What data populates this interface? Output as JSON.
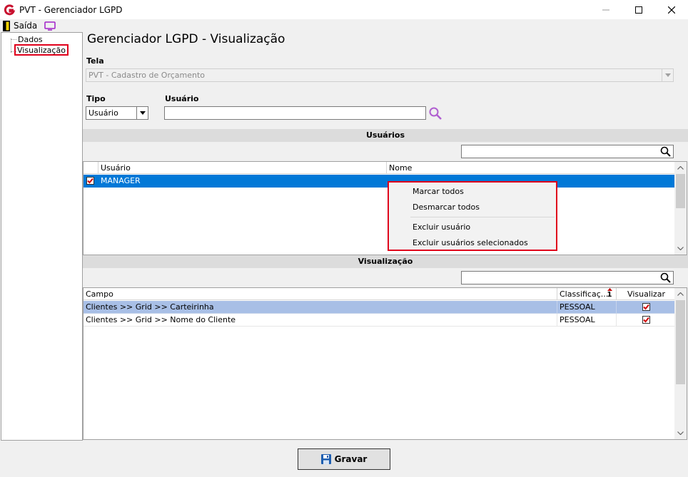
{
  "window": {
    "title": "PVT - Gerenciador LGPD"
  },
  "toolbar": {
    "exit_label": "Saída"
  },
  "sidebar": {
    "items": [
      {
        "label": "Dados"
      },
      {
        "label": "Visualização"
      }
    ]
  },
  "page_title": "Gerenciador LGPD - Visualização",
  "tela": {
    "label": "Tela",
    "value": "PVT - Cadastro de Orçamento"
  },
  "tipo": {
    "label": "Tipo",
    "value": "Usuário"
  },
  "usuario": {
    "label": "Usuário",
    "value": ""
  },
  "usuarios_section": {
    "title": "Usuários",
    "columns": [
      "Usuário",
      "Nome"
    ],
    "rows": [
      {
        "checked": true,
        "usuario": "MANAGER",
        "nome": ""
      }
    ]
  },
  "context_menu": {
    "items": [
      "Marcar todos",
      "Desmarcar todos",
      "Excluir usuário",
      "Excluir usuários selecionados"
    ]
  },
  "visualizacao_section": {
    "title": "Visualização",
    "columns": [
      "Campo",
      "Classificaç...",
      "Visualizar"
    ],
    "sort_indicator": "1",
    "rows": [
      {
        "campo": "Clientes >> Grid >> Carteirinha",
        "classificacao": "PESSOAL",
        "visualizar": true
      },
      {
        "campo": "Clientes >> Grid >> Nome do Cliente",
        "classificacao": "PESSOAL",
        "visualizar": true
      }
    ]
  },
  "save_button": {
    "label": "Gravar"
  },
  "colors": {
    "selection": "#0078d7",
    "row_highlight": "#a8bfe6",
    "accent_red": "#e0001b"
  }
}
